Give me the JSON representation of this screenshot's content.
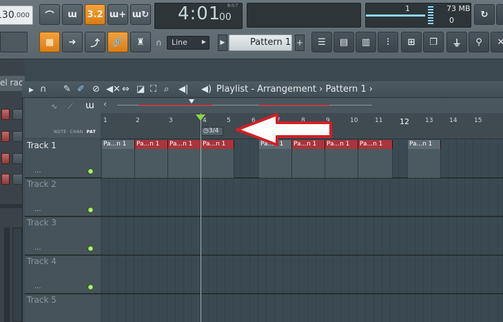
{
  "toolbar": {
    "tempo_main": "130",
    "tempo_fraction": ".000",
    "time_main": "4:01",
    "time_sub": "00",
    "time_format": "B:S:T",
    "typing_keyboard_label": "3.2",
    "cpu_value": "1",
    "memory_value": "73 MB",
    "polyphony_value": "0",
    "snap_select": "Line",
    "pattern_select": "Pattern 1",
    "add_pattern": "+"
  },
  "left_panel": {
    "title": "el rac"
  },
  "playlist": {
    "title": "Playlist - Arrangement",
    "breadcrumb_sep": "›",
    "pattern_crumb": "Pattern 1",
    "mode_labels": {
      "note": "NOTE",
      "chan": "CHAN",
      "pat": "PAT"
    },
    "time_signature": "3/4",
    "bars": [
      "1",
      "2",
      "3",
      "4",
      "5",
      "6",
      "7",
      "8",
      "9",
      "10",
      "11",
      "12",
      "13",
      "14",
      "15"
    ],
    "tracks": [
      {
        "name": "Track 1",
        "dots": "..."
      },
      {
        "name": "Track 2",
        "dots": "..."
      },
      {
        "name": "Track 3",
        "dots": "..."
      },
      {
        "name": "Track 4",
        "dots": "..."
      },
      {
        "name": "Track 5",
        "dots": ""
      }
    ],
    "clip_label": "Pa...n 1"
  },
  "colors": {
    "accent_orange": "#e8901f",
    "clip_red": "#a8353c",
    "clip_gray": "#5f6b72",
    "led_green": "#7fd14a",
    "arrow_red": "#d21f26"
  }
}
